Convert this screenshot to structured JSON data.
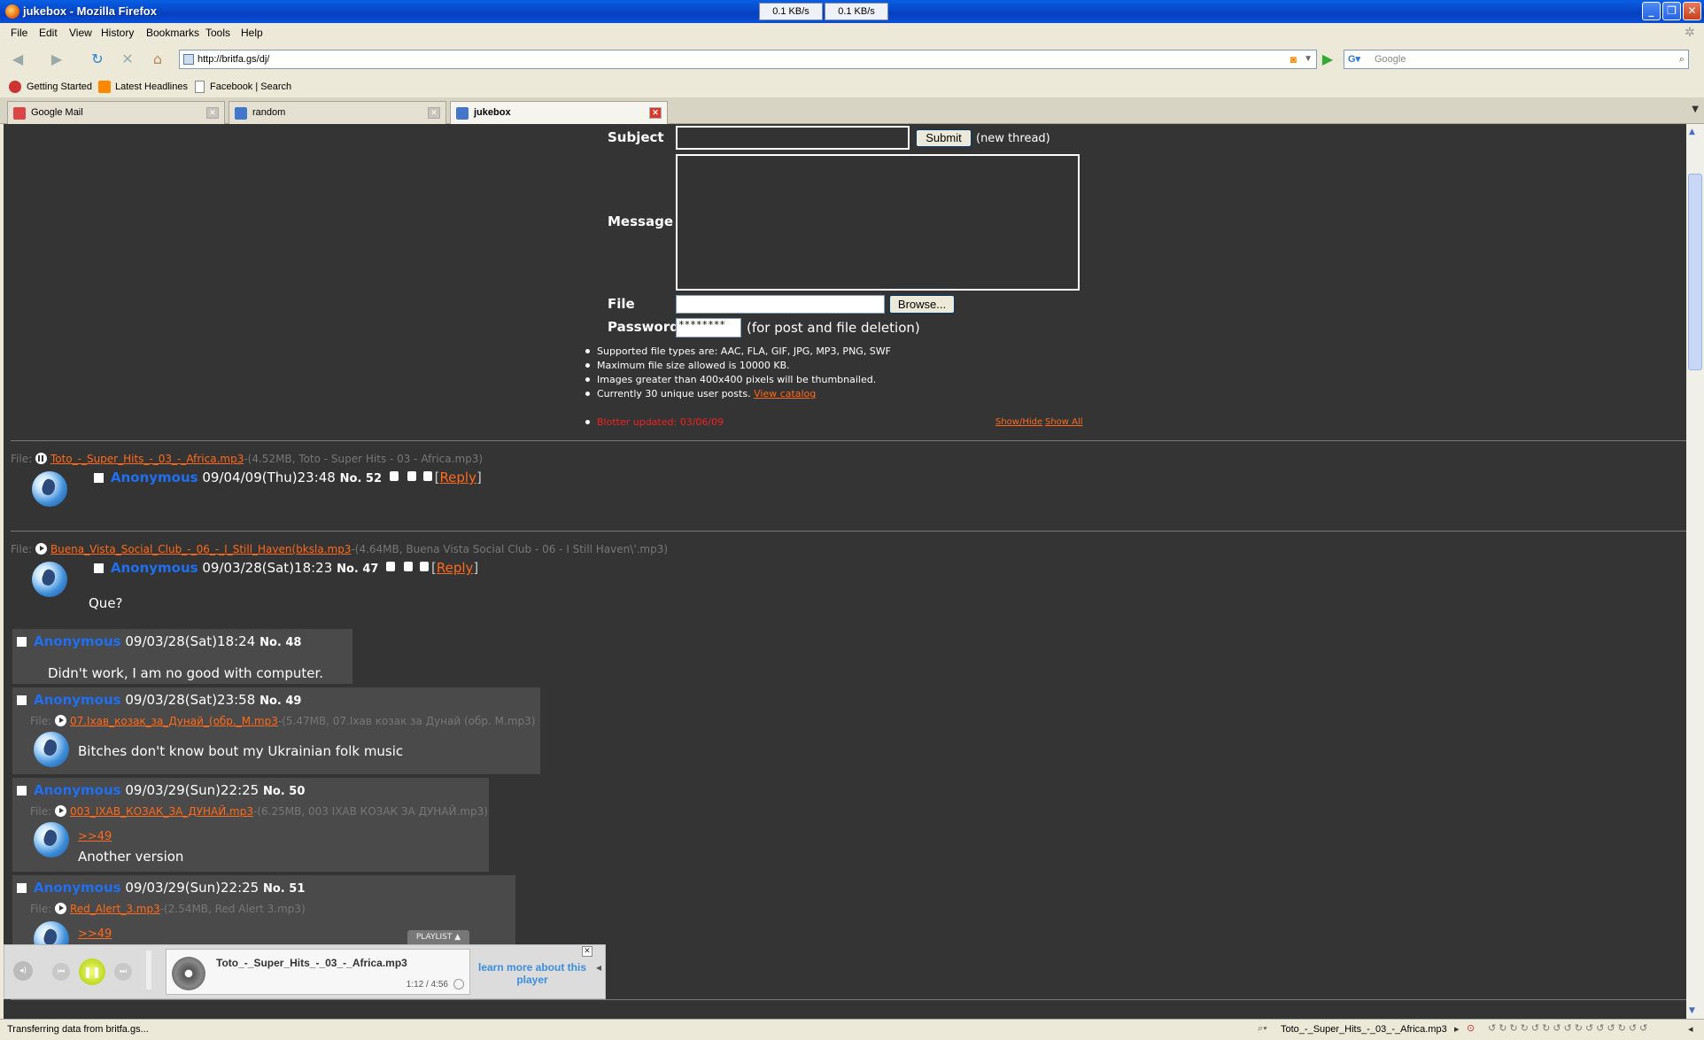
{
  "window": {
    "title": "jukebox - Mozilla Firefox",
    "speed_down": "0.1 KB/s",
    "speed_up": "0.1 KB/s"
  },
  "menu": [
    "File",
    "Edit",
    "View",
    "History",
    "Bookmarks",
    "Tools",
    "Help"
  ],
  "nav": {
    "url": "http://britfa.gs/dj/",
    "search_placeholder": "Google"
  },
  "bookmarks": [
    "Getting Started",
    "Latest Headlines",
    "Facebook | Search"
  ],
  "tabs": [
    {
      "label": "Google Mail",
      "selected": false
    },
    {
      "label": "random",
      "selected": false
    },
    {
      "label": "jukebox",
      "selected": true
    }
  ],
  "form": {
    "subject_label": "Subject",
    "submit_label": "Submit",
    "new_thread_note": "(new thread)",
    "message_label": "Message",
    "file_label": "File",
    "browse_label": "Browse...",
    "password_label": "Password",
    "password_value": "********",
    "password_note": "(for post and file deletion)",
    "rules": [
      "Supported file types are: AAC, FLA, GIF, JPG, MP3, PNG, SWF",
      "Maximum file size allowed is 10000 KB.",
      "Images greater than 400x400 pixels will be thumbnailed.",
      "Currently 30 unique user posts."
    ],
    "view_catalog": "View catalog",
    "blotter": "Blotter updated: 03/06/09",
    "show_hide": "Show/Hide",
    "show_all": "Show All"
  },
  "threads": [
    {
      "file_label": "File:",
      "file_name": "Toto_-_Super_Hits_-_03_-_Africa.mp3",
      "file_meta": "-(4.52MB, Toto - Super Hits - 03 - Africa.mp3)",
      "name": "Anonymous",
      "date": "09/04/09(Thu)23:48",
      "no": "No. 52",
      "reply": "Reply"
    },
    {
      "file_label": "File:",
      "file_name": "Buena_Vista_Social_Club_-_06_-_I_Still_Haven(bksla.mp3",
      "file_meta": "-(4.64MB, Buena Vista Social Club - 06 - I Still Haven\\'.mp3)",
      "name": "Anonymous",
      "date": "09/03/28(Sat)18:23",
      "no": "No. 47",
      "reply": "Reply",
      "text": "Que?"
    }
  ],
  "replies": [
    {
      "name": "Anonymous",
      "date": "09/03/28(Sat)18:24",
      "no": "No. 48",
      "text": "Didn't work, I am no good with computer."
    },
    {
      "name": "Anonymous",
      "date": "09/03/28(Sat)23:58",
      "no": "No. 49",
      "file_label": "File:",
      "file_name": "07.Іхав_козак_за_Дунай_(обр._М.mp3",
      "file_meta": "-(5.47MB, 07.Іхав козак за Дунай (обр. М.mp3)",
      "text": "Bitches don't know bout my Ukrainian folk music"
    },
    {
      "name": "Anonymous",
      "date": "09/03/29(Sun)22:25",
      "no": "No. 50",
      "file_label": "File:",
      "file_name": "003_ІХАВ_КОЗАК_ЗА_ДУНАЙ.mp3",
      "file_meta": "-(6.25MB, 003 ІХАВ КОЗАК ЗА ДУНАЙ.mp3)",
      "quote": ">>49",
      "text": "Another version"
    },
    {
      "name": "Anonymous",
      "date": "09/03/29(Sun)22:25",
      "no": "No. 51",
      "file_label": "File:",
      "file_name": "Red_Alert_3.mp3",
      "file_meta": "-(2.54MB, Red Alert 3.mp3)",
      "quote": ">>49"
    }
  ],
  "player": {
    "playlist": "PLAYLIST ▲",
    "track": "Toto_-_Super_Hits_-_03_-_Africa.mp3",
    "time": "1:12 / 4:56",
    "learn_more": "learn more about this player"
  },
  "status": {
    "left": "Transferring data from britfa.gs...",
    "track": "Toto_-_Super_Hits_-_03_-_Africa.mp3"
  }
}
